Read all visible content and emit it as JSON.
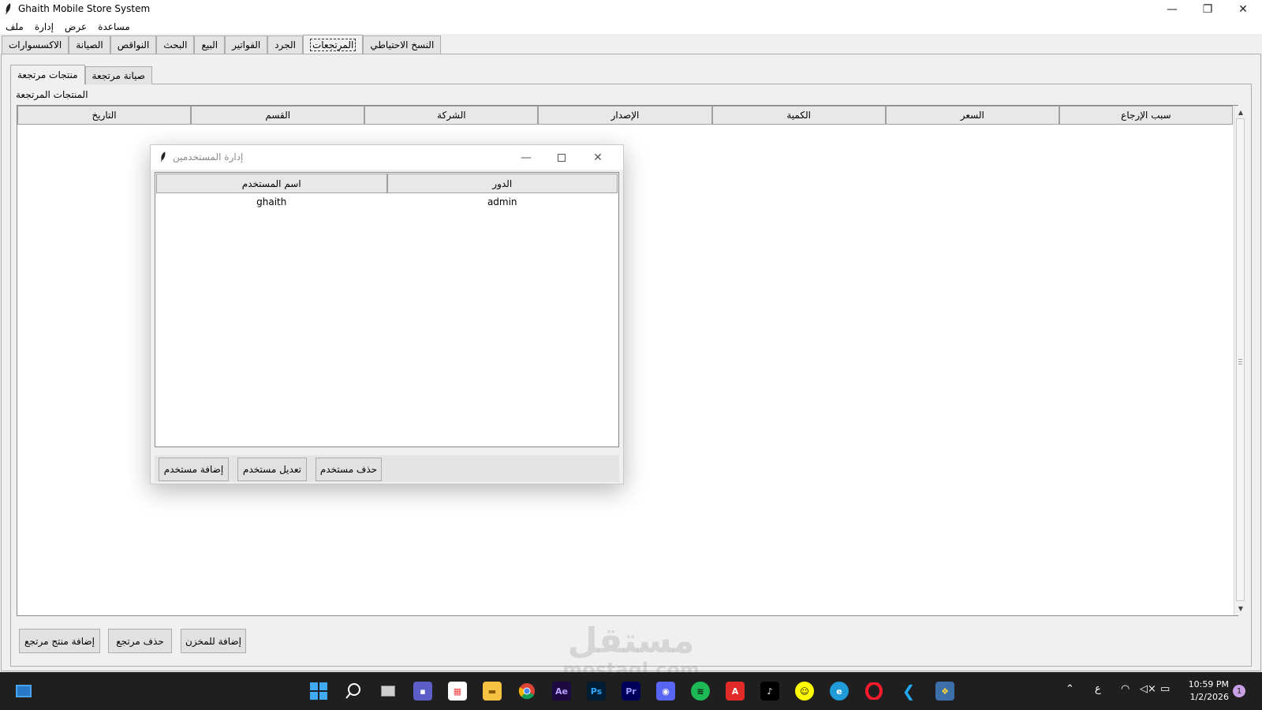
{
  "window": {
    "title": "Ghaith Mobile Store System",
    "controls": {
      "minimize": "—",
      "restore": "❐",
      "close": "✕"
    }
  },
  "menu": [
    "ملف",
    "إدارة",
    "عرض",
    "مساعدة"
  ],
  "main_tabs": [
    "الاكسسوارات",
    "الصيانة",
    "النواقص",
    "البحث",
    "البيع",
    "الفواتير",
    "الجرد",
    "المرتجعات",
    "النسخ الاحتياطي"
  ],
  "active_main_tab": "المرتجعات",
  "sub_tabs": [
    "منتجات مرتجعة",
    "صيانة مرتجعة"
  ],
  "group_label": "المنتجات المرتجعة",
  "table": {
    "columns": [
      "التاريخ",
      "القسم",
      "الشركة",
      "الإصدار",
      "الكمية",
      "السعر",
      "سبب الإرجاع"
    ]
  },
  "bottom_buttons": {
    "add_return": "إضافة منتج مرتجع",
    "delete_return": "حذف مرتجع",
    "add_to_stock": "إضافة للمخزن"
  },
  "dialog": {
    "title": "إدارة المستخدمين",
    "columns": [
      "اسم المستخدم",
      "الدور"
    ],
    "rows": [
      {
        "username": "ghaith",
        "role": "admin"
      }
    ],
    "buttons": {
      "add_user": "إضافة مستخدم",
      "edit_user": "تعديل مستخدم",
      "delete_user": "حذف مستخدم"
    }
  },
  "watermark": {
    "arabic": "مستقل",
    "latin": "mostaql.com"
  },
  "taskbar": {
    "clock_time": "10:59 PM",
    "clock_date": "1/2/2026",
    "language": "ع",
    "notification_count": "1",
    "apps": [
      "windows-start",
      "search",
      "task-view",
      "teams-chat",
      "microsoft-store",
      "file-explorer",
      "chrome",
      "after-effects",
      "photoshop",
      "premiere-pro",
      "discord",
      "spotify",
      "acrobat",
      "tiktok",
      "snapchat",
      "edge",
      "opera",
      "vscode",
      "python"
    ]
  },
  "colors": {
    "window_bg": "#f0f0f0",
    "taskbar_bg": "#1f1f1f",
    "table_bg": "#ffffff",
    "header_bg": "#e8e8e8"
  }
}
